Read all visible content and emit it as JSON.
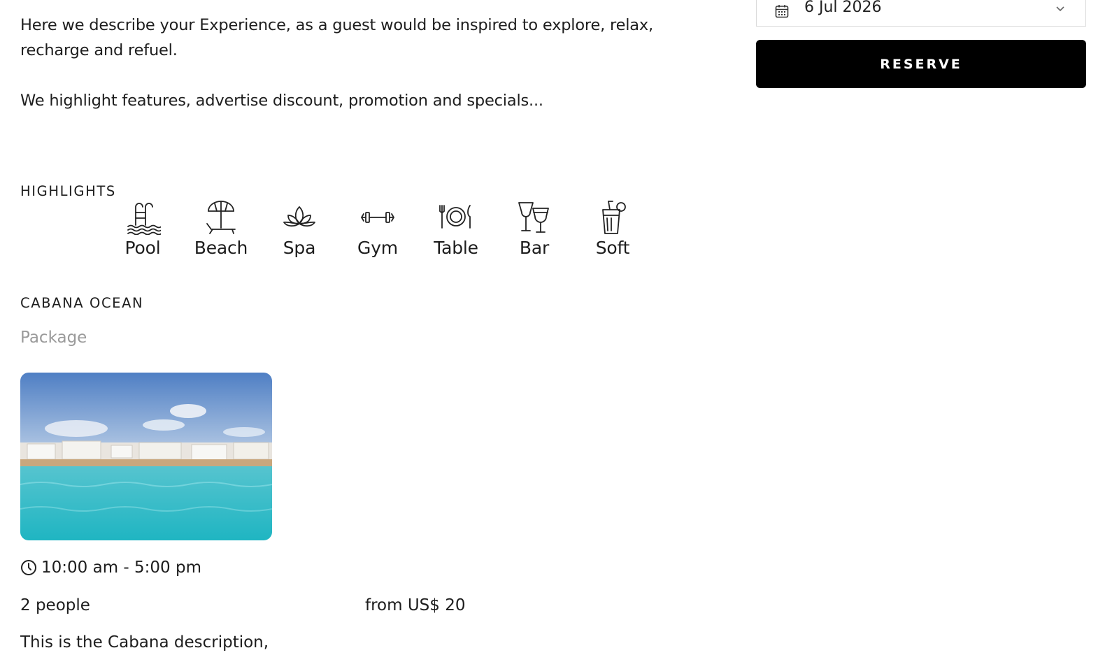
{
  "intro": {
    "paragraph1": "Here we describe your Experience, as a guest would be inspired to explore, relax, recharge and refuel.",
    "paragraph2": "We highlight features, advertise discount, promotion and specials..."
  },
  "booking": {
    "date": "6 Jul 2026",
    "reserve_label": "RESERVE"
  },
  "highlights": {
    "title": "HIGHLIGHTS",
    "items": [
      {
        "label": "Pool",
        "icon": "pool-icon"
      },
      {
        "label": "Beach",
        "icon": "beach-umbrella-icon"
      },
      {
        "label": "Spa",
        "icon": "lotus-icon"
      },
      {
        "label": "Gym",
        "icon": "dumbbell-icon"
      },
      {
        "label": "Table",
        "icon": "plate-cutlery-icon"
      },
      {
        "label": "Bar",
        "icon": "cocktail-glasses-icon"
      },
      {
        "label": "Soft",
        "icon": "soft-drink-icon"
      }
    ]
  },
  "cabana": {
    "title": "CABANA OCEAN",
    "subtitle": "Package",
    "time": "10:00 am - 5:00 pm",
    "people": "2 people",
    "price": "from US$ 20",
    "description": "This is the Cabana description,"
  },
  "colors": {
    "accent": "#000000",
    "muted_text": "#9a9a9a",
    "body_text": "#1d1d1d"
  }
}
